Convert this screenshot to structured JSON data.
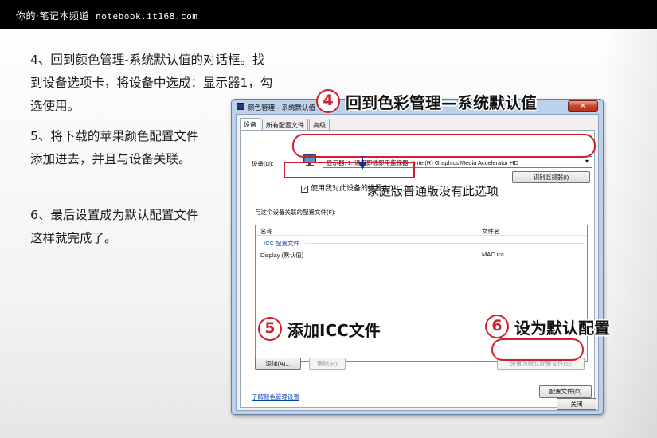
{
  "header": {
    "brand": "你的·笔记本频道",
    "url": "notebook.it168.com"
  },
  "steps": [
    {
      "lines": [
        "4、回到颜色管理-系统默认值的对话框。找",
        "到设备选项卡，将设备中选成：显示器1，勾",
        "选使用。"
      ]
    },
    {
      "lines": [
        "5、将下载的苹果颜色配置文件",
        "添加进去，并且与设备关联。"
      ]
    },
    {
      "lines": [
        "6、最后设置成为默认配置文件",
        "这样就完成了。"
      ]
    }
  ],
  "dialog": {
    "title": "颜色管理 - 系统默认值",
    "close_label": "✕",
    "tabs": [
      "设备",
      "所有配置文件",
      "高级"
    ],
    "device_label": "设备(D):",
    "device_value": "显示器: 1. 通用即插即用监视器 - Intel(R) Graphics Media Accelerator HD",
    "identify_button": "识别监视器(I)",
    "use_settings_checkbox": "使用我对此设备的设置(U)",
    "use_settings_checked": true,
    "profiles_label": "与这个设备关联的配置文件(F):",
    "columns": [
      "名称",
      "文件名"
    ],
    "group_name": "ICC 配置文件",
    "rows": [
      {
        "name": "Display (默认值)",
        "file": "MAC.icc"
      }
    ],
    "add_button": "添加(A)...",
    "remove_button": "删除(R)",
    "set_default_button": "设置为默认配置文件(S)",
    "learn_link": "了解颜色管理设置",
    "profiles_button": "配置文件(O)",
    "close_button": "关闭"
  },
  "annotations": {
    "step4_num": "4",
    "step4_title": "回到色彩管理—系统默认值",
    "step4_note": "家庭版普通版没有此选项",
    "step5_num": "5",
    "step5_title": "添加ICC文件",
    "step6_num": "6",
    "step6_title": "设为默认配置"
  },
  "colors": {
    "highlight": "#d0202a",
    "arrow": "#1a2a8c",
    "link": "#0645ad"
  }
}
